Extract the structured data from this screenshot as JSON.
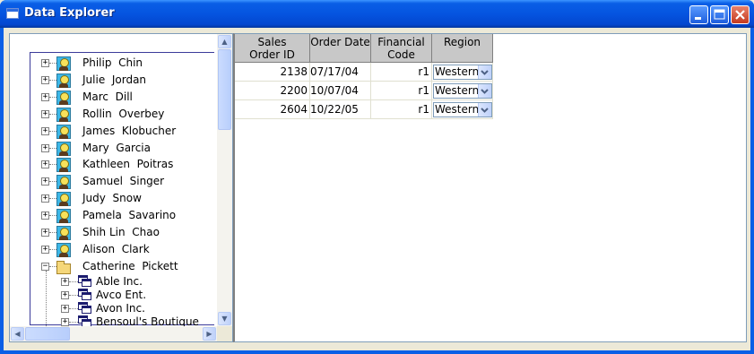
{
  "window": {
    "title": "Data Explorer"
  },
  "tree": {
    "customers": [
      {
        "first": "Philip",
        "last": "Chin"
      },
      {
        "first": "Julie",
        "last": "Jordan"
      },
      {
        "first": "Marc",
        "last": "Dill"
      },
      {
        "first": "Rollin",
        "last": "Overbey"
      },
      {
        "first": "James",
        "last": "Klobucher"
      },
      {
        "first": "Mary",
        "last": "Garcia"
      },
      {
        "first": "Kathleen",
        "last": "Poitras"
      },
      {
        "first": "Samuel",
        "last": "Singer"
      },
      {
        "first": "Judy",
        "last": "Snow"
      },
      {
        "first": "Pamela",
        "last": "Savarino"
      },
      {
        "first": "Shih Lin",
        "last": "Chao"
      },
      {
        "first": "Alison",
        "last": "Clark"
      },
      {
        "first": "Catherine",
        "last": "Pickett"
      }
    ],
    "children": [
      "Able Inc.",
      "Avco Ent.",
      "Avon Inc.",
      "Bensoul's Boutique"
    ]
  },
  "grid": {
    "columns": [
      "Sales\nOrder ID",
      "Order Date",
      "Financial\nCode",
      "Region"
    ],
    "rows": [
      {
        "id": "2138",
        "date": "07/17/04",
        "code": "r1",
        "region": "Western"
      },
      {
        "id": "2200",
        "date": "10/07/04",
        "code": "r1",
        "region": "Western"
      },
      {
        "id": "2604",
        "date": "10/22/05",
        "code": "r1",
        "region": "Western"
      }
    ]
  }
}
